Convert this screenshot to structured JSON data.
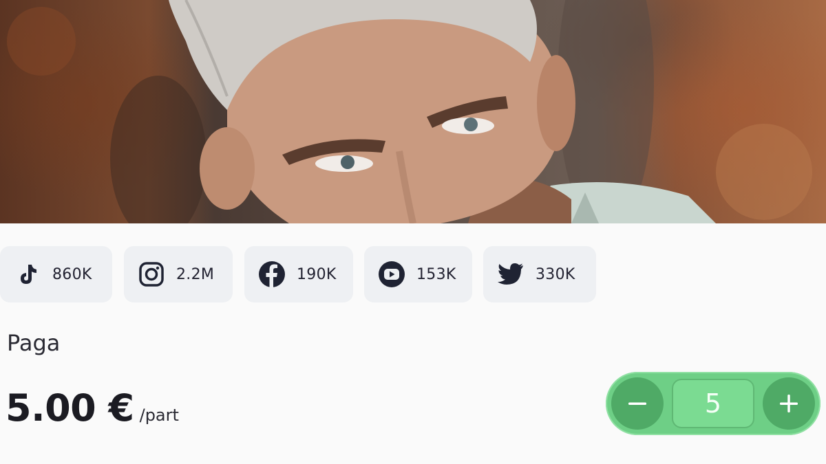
{
  "hero": {
    "image": "profile-photo"
  },
  "socials": [
    {
      "platform": "tiktok",
      "icon": "tiktok-icon",
      "count": "860K"
    },
    {
      "platform": "instagram",
      "icon": "instagram-icon",
      "count": "2.2M"
    },
    {
      "platform": "facebook",
      "icon": "facebook-icon",
      "count": "190K"
    },
    {
      "platform": "youtube",
      "icon": "youtube-icon",
      "count": "153K"
    },
    {
      "platform": "twitter",
      "icon": "twitter-icon",
      "count": "330K"
    }
  ],
  "pricing": {
    "label": "Paga",
    "amount": "5.00 €",
    "unit": "/part"
  },
  "stepper": {
    "decrement_icon": "minus-icon",
    "increment_icon": "plus-icon",
    "quantity": "5"
  },
  "colors": {
    "chip_bg": "#eef0f3",
    "icon": "#1f2333",
    "stepper_bg": "#6ecf86",
    "stepper_button": "#4faa66"
  }
}
